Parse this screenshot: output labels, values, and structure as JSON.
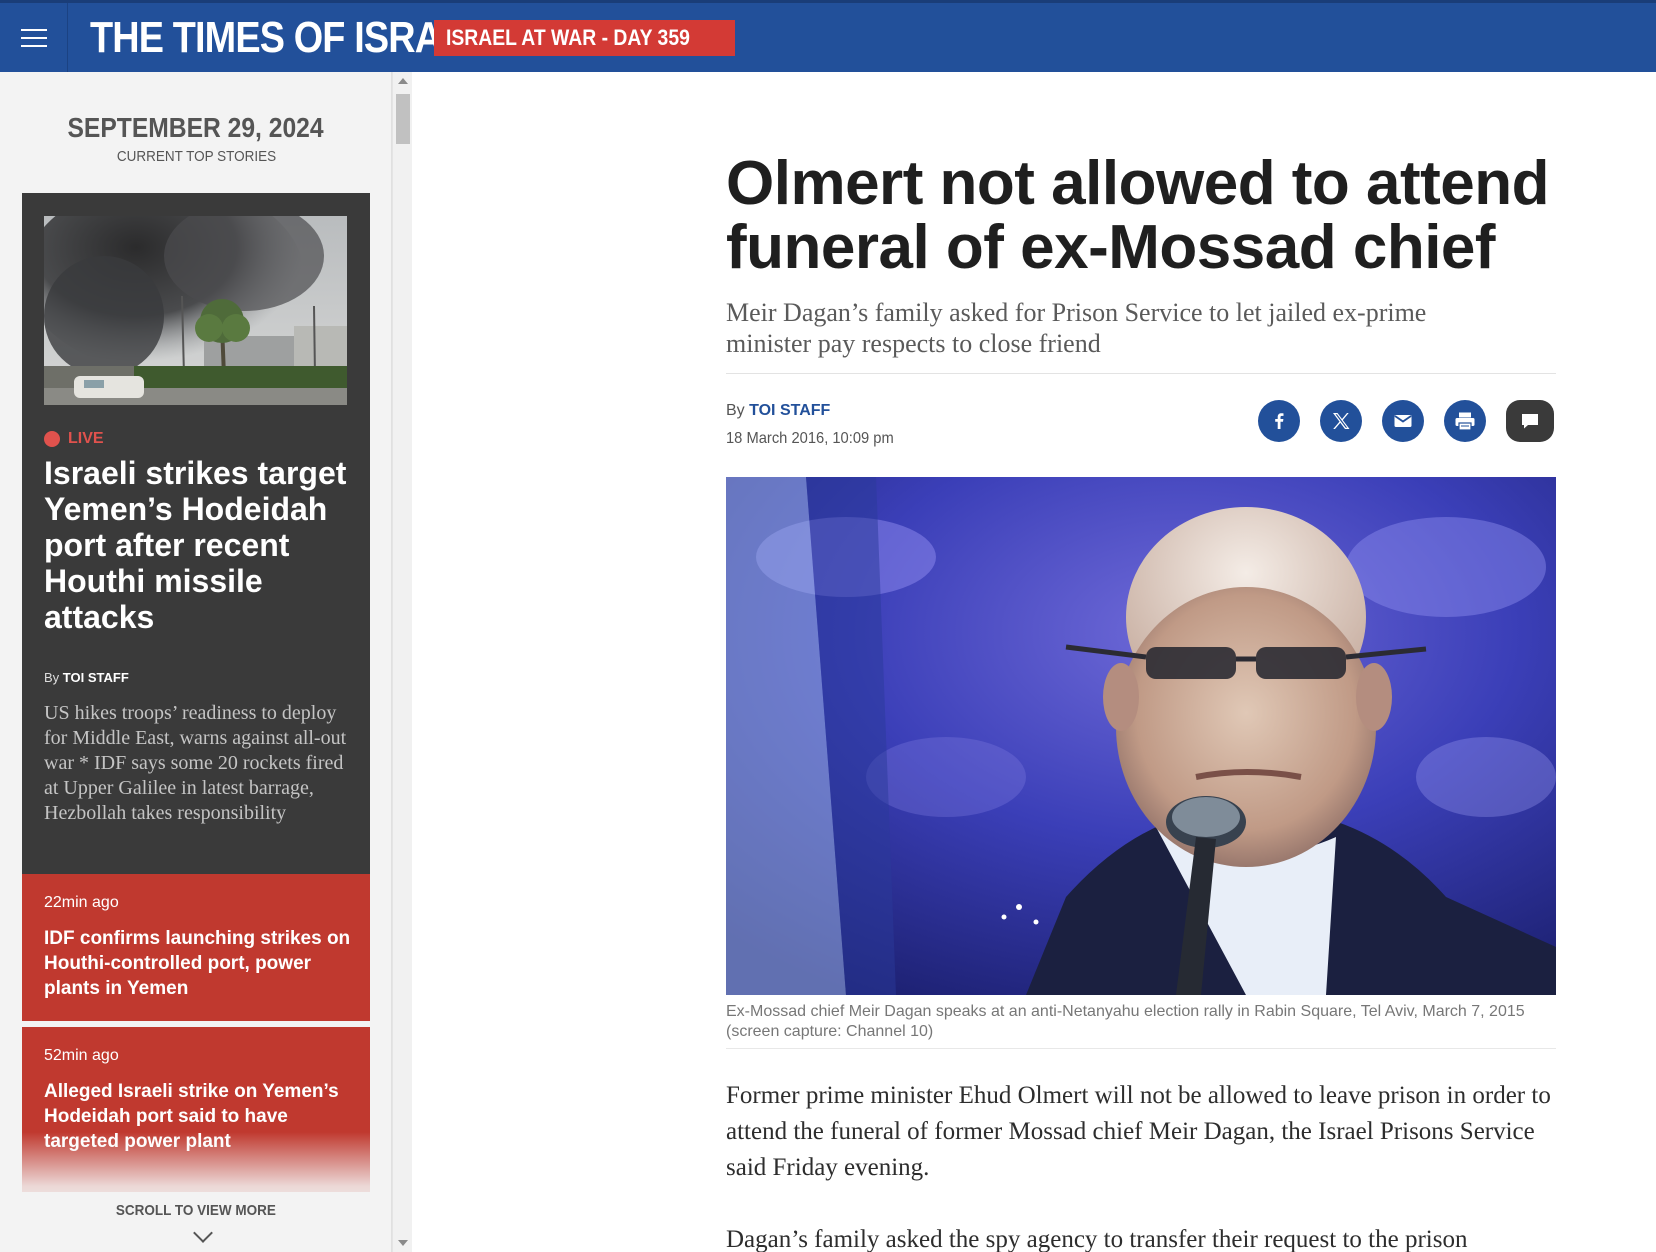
{
  "header": {
    "logo": "THE TIMES OF ISRAEL",
    "war_badge": "ISRAEL AT WAR - DAY 359",
    "colors": {
      "bar": "#22509a",
      "badge": "#d33a35"
    }
  },
  "sidebar": {
    "date": "SEPTEMBER 29, 2024",
    "subtitle": "CURRENT TOP STORIES",
    "live_story": {
      "tag": "LIVE",
      "title": "Israeli strikes target Yemen’s Hodeidah port after recent Houthi missile attacks",
      "by_prefix": "By",
      "author": "TOI STAFF",
      "description": "US hikes troops’ readiness to deploy for Middle East, warns against all-out war * IDF says some 20 rockets fired at Upper Galilee in latest barrage, Hezbollah takes responsibility"
    },
    "updates": [
      {
        "time": "22min ago",
        "title": "IDF confirms launching strikes on Houthi-controlled port, power plants in Yemen"
      },
      {
        "time": "52min ago",
        "title": "Alleged Israeli strike on Yemen’s Hodeidah port said to have targeted power plant"
      }
    ],
    "scroll_more": "SCROLL TO VIEW MORE"
  },
  "article": {
    "headline": "Olmert not allowed to attend funeral of ex-Mossad chief",
    "subhead": "Meir Dagan’s family asked for Prison Service to let jailed ex-prime minister pay respects to close friend",
    "by_prefix": "By",
    "author": "TOI STAFF",
    "date": "18 March 2016, 10:09 pm",
    "share_icons": [
      "facebook-icon",
      "x-icon",
      "email-icon",
      "print-icon",
      "comment-icon"
    ],
    "caption": "Ex-Mossad chief Meir Dagan speaks at an anti-Netanyahu election rally in Rabin Square, Tel Aviv, March 7, 2015 (screen capture: Channel 10)",
    "paragraphs": [
      "Former prime minister Ehud Olmert will not be allowed to leave prison in order to attend the funeral of former Mossad chief Meir Dagan, the Israel Prisons Service said Friday evening.",
      "Dagan’s family asked the spy agency to transfer their request to the prison"
    ]
  }
}
